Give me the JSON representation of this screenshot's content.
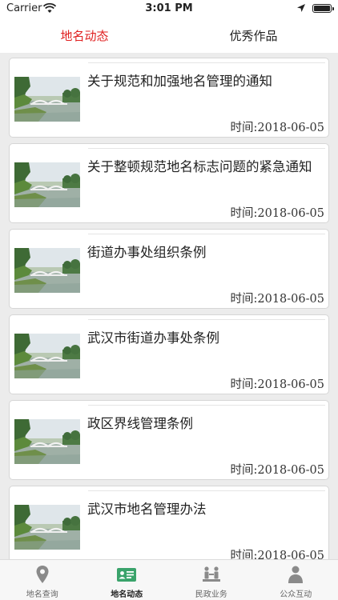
{
  "status_bar": {
    "carrier": "Carrier",
    "time": "3:01 PM"
  },
  "top_tabs": [
    {
      "label": "地名动态",
      "active": true
    },
    {
      "label": "优秀作品",
      "active": false
    }
  ],
  "articles": [
    {
      "title": "关于规范和加强地名管理的通知",
      "time": "时间:2018-06-05"
    },
    {
      "title": "关于整顿规范地名标志问题的紧急通知",
      "time": "时间:2018-06-05"
    },
    {
      "title": "街道办事处组织条例",
      "time": "时间:2018-06-05"
    },
    {
      "title": "武汉市街道办事处条例",
      "time": "时间:2018-06-05"
    },
    {
      "title": "政区界线管理条例",
      "time": "时间:2018-06-05"
    },
    {
      "title": "武汉市地名管理办法",
      "time": "时间:2018-06-05"
    }
  ],
  "tabbar": [
    {
      "label": "地名查询",
      "icon": "location-pin-icon"
    },
    {
      "label": "地名动态",
      "icon": "id-card-icon",
      "active": true
    },
    {
      "label": "民政业务",
      "icon": "people-service-icon"
    },
    {
      "label": "公众互动",
      "icon": "person-icon"
    }
  ],
  "colors": {
    "active_tab": "#e02020",
    "list_bg": "#ececec",
    "tab_active_icon": "#3aa36b",
    "tab_icon": "#888888"
  }
}
